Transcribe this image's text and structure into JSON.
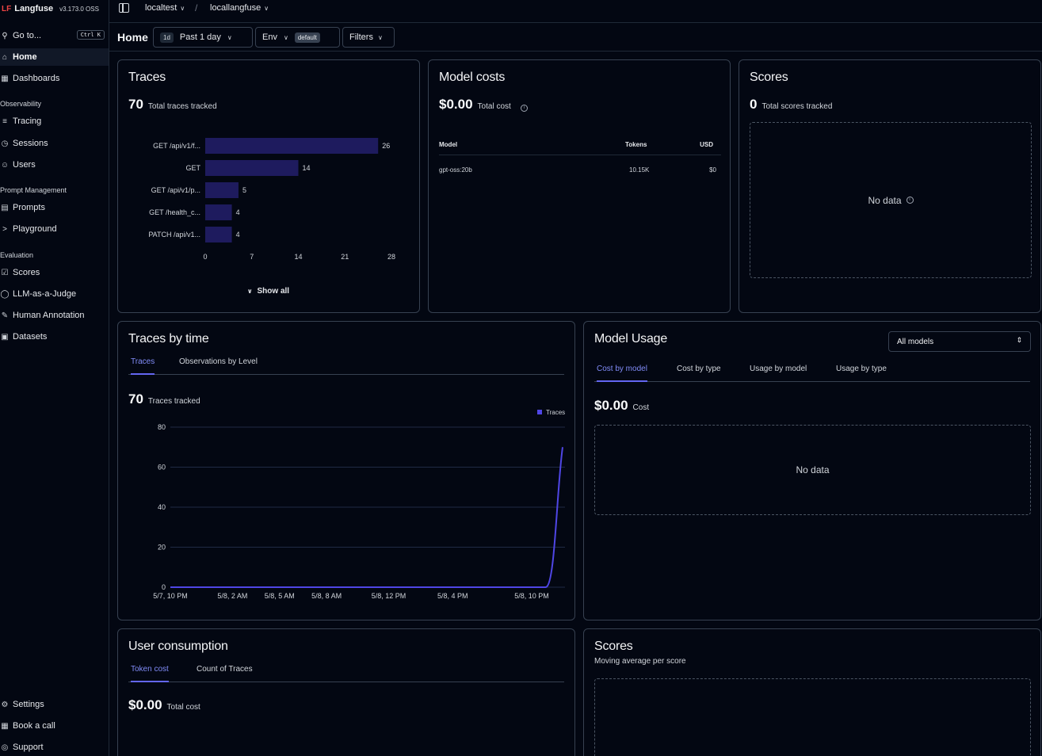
{
  "app": {
    "logo": "LF",
    "name": "Langfuse",
    "version": "v3.173.0 OSS"
  },
  "breadcrumb": {
    "org": "localtest",
    "project": "locallangfuse"
  },
  "sidebar": {
    "goto": {
      "label": "Go to...",
      "shortcut": "Ctrl K"
    },
    "items": {
      "home": "Home",
      "dashboards": "Dashboards",
      "tracing": "Tracing",
      "sessions": "Sessions",
      "users": "Users",
      "prompts": "Prompts",
      "playground": "Playground",
      "scores": "Scores",
      "llm_judge": "LLM-as-a-Judge",
      "human_annotation": "Human Annotation",
      "datasets": "Datasets",
      "settings": "Settings",
      "book_call": "Book a call",
      "support": "Support"
    },
    "sections": {
      "observability": "Observability",
      "prompt_mgmt": "Prompt Management",
      "evaluation": "Evaluation"
    }
  },
  "toolbar": {
    "title": "Home",
    "date_tag": "1d",
    "date_label": "Past 1 day",
    "env_label": "Env",
    "env_value": "default",
    "filters_label": "Filters"
  },
  "traces_card": {
    "title": "Traces",
    "count": "70",
    "count_label": "Total traces tracked",
    "show_all": "Show all"
  },
  "model_costs": {
    "title": "Model costs",
    "total": "$0.00",
    "total_label": "Total cost",
    "headers": {
      "model": "Model",
      "tokens": "Tokens",
      "usd": "USD"
    },
    "rows": [
      {
        "model": "gpt-oss:20b",
        "tokens": "10.15K",
        "usd": "$0"
      }
    ]
  },
  "scores_card": {
    "title": "Scores",
    "count": "0",
    "count_label": "Total scores tracked",
    "empty": "No data"
  },
  "traces_by_time": {
    "title": "Traces by time",
    "tabs": [
      "Traces",
      "Observations by Level"
    ],
    "count": "70",
    "count_label": "Traces tracked",
    "legend": "Traces"
  },
  "model_usage": {
    "title": "Model Usage",
    "select": "All models",
    "tabs": [
      "Cost by model",
      "Cost by type",
      "Usage by model",
      "Usage by type"
    ],
    "total": "$0.00",
    "total_label": "Cost",
    "empty": "No data"
  },
  "user_consumption": {
    "title": "User consumption",
    "tabs": [
      "Token cost",
      "Count of Traces"
    ],
    "total": "$0.00",
    "total_label": "Total cost"
  },
  "scores_time": {
    "title": "Scores",
    "subtitle": "Moving average per score"
  },
  "colors": {
    "accent": "#6366f1",
    "bar": "#1e1b5e",
    "line": "#4f46e5"
  },
  "chart_data": [
    {
      "type": "bar",
      "orientation": "horizontal",
      "categories": [
        "GET /api/v1/f...",
        "GET",
        "GET /api/v1/p...",
        "GET /health_c...",
        "PATCH /api/v1..."
      ],
      "values": [
        26,
        14,
        5,
        4,
        4
      ],
      "xlim": [
        0,
        28
      ],
      "xticks": [
        0,
        7,
        14,
        21,
        28
      ],
      "title": "",
      "xlabel": "",
      "ylabel": ""
    },
    {
      "type": "line",
      "series": [
        {
          "name": "Traces",
          "values": [
            0,
            0,
            0,
            0,
            0,
            0,
            0,
            0,
            0,
            0,
            0,
            0,
            0,
            0,
            0,
            0,
            0,
            0,
            0,
            0,
            0,
            0,
            0,
            70
          ]
        }
      ],
      "xticks": [
        "5/7, 10 PM",
        "5/8, 2 AM",
        "5/8, 5 AM",
        "5/8, 8 AM",
        "5/8, 12 PM",
        "5/8, 4 PM",
        "5/8, 10 PM"
      ],
      "ylim": [
        0,
        80
      ],
      "yticks": [
        0,
        20,
        40,
        60,
        80
      ],
      "grid": true,
      "legend": "top-right"
    }
  ]
}
